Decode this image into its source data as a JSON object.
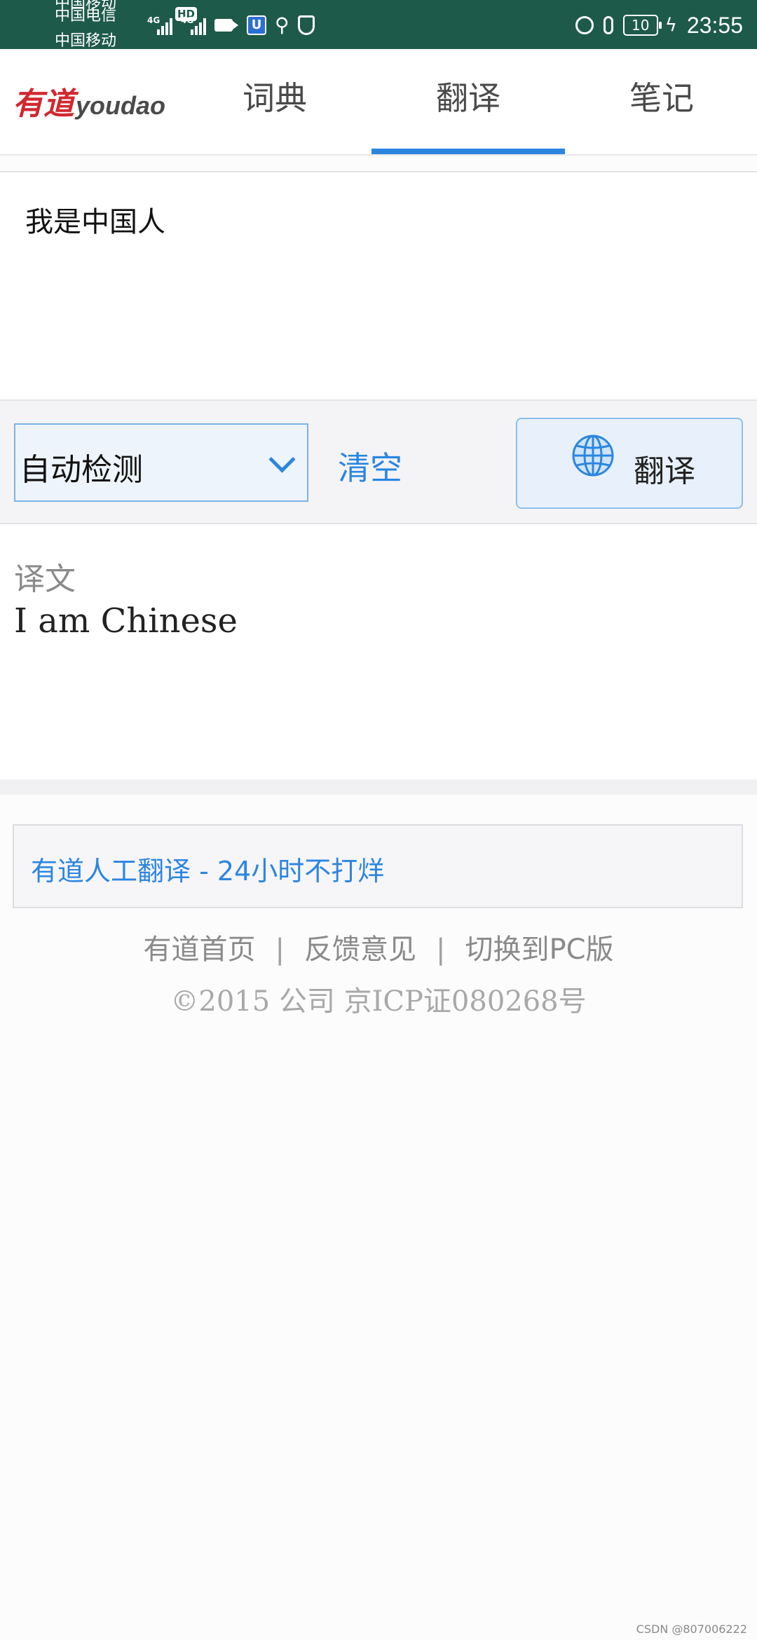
{
  "status_bar": {
    "carriers": [
      "中国移动",
      "中国电信",
      "中国移动"
    ],
    "hd_badge": "HD",
    "network_labels": [
      "4G",
      "4G"
    ],
    "vpn_badge": "U",
    "battery": "10",
    "time": "23:55"
  },
  "header": {
    "logo_cn": "有道",
    "logo_en": "youdao",
    "tabs": [
      {
        "label": "词典",
        "active": false
      },
      {
        "label": "翻译",
        "active": true
      },
      {
        "label": "笔记",
        "active": false
      }
    ]
  },
  "input": {
    "value": "我是中国人"
  },
  "controls": {
    "language_select": "自动检测",
    "clear_label": "清空",
    "translate_label": "翻译"
  },
  "result": {
    "label": "译文",
    "text": "I am Chinese"
  },
  "human_translation": {
    "text": "有道人工翻译 - 24小时不打烊"
  },
  "footer": {
    "links": [
      "有道首页",
      "反馈意见",
      "切换到PC版"
    ],
    "separator": "|",
    "copyright": "©2015 公司 京ICP证080268号"
  },
  "watermark": "CSDN @807006222",
  "colors": {
    "status_bar_bg": "#1e5a4a",
    "accent_blue": "#2b86e0",
    "logo_red": "#d0282e"
  }
}
